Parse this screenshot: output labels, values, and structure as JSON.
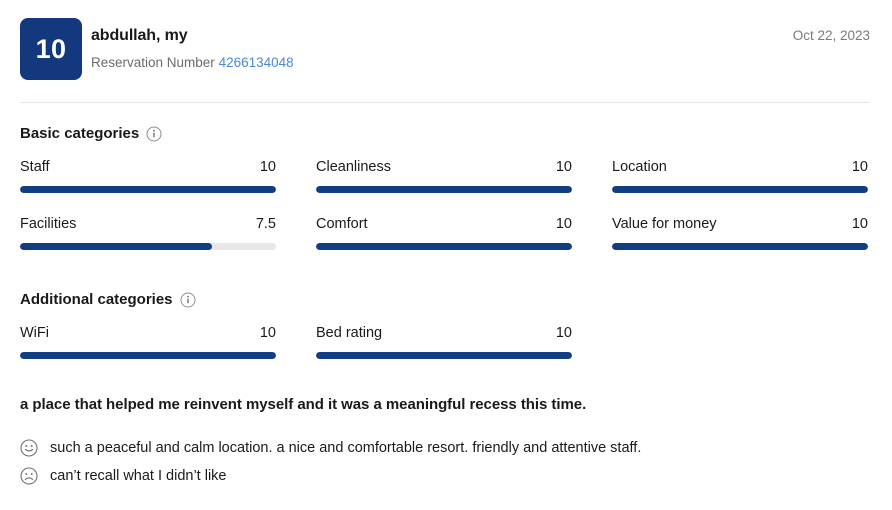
{
  "header": {
    "score": "10",
    "reviewer_name": "abdullah, my",
    "reservation_label": "Reservation Number",
    "reservation_number": "4266134048",
    "date": "Oct 22, 2023"
  },
  "sections": {
    "basic": {
      "title": "Basic categories",
      "info_icon": "info-icon",
      "ratings": [
        {
          "label": "Staff",
          "value": "10",
          "percent": 100
        },
        {
          "label": "Cleanliness",
          "value": "10",
          "percent": 100
        },
        {
          "label": "Location",
          "value": "10",
          "percent": 100
        },
        {
          "label": "Facilities",
          "value": "7.5",
          "percent": 75
        },
        {
          "label": "Comfort",
          "value": "10",
          "percent": 100
        },
        {
          "label": "Value for money",
          "value": "10",
          "percent": 100
        }
      ]
    },
    "additional": {
      "title": "Additional categories",
      "info_icon": "info-icon",
      "ratings": [
        {
          "label": "WiFi",
          "value": "10",
          "percent": 100
        },
        {
          "label": "Bed rating",
          "value": "10",
          "percent": 100
        }
      ]
    }
  },
  "review": {
    "title": "a place that helped me reinvent myself and it was a meaningful recess this time.",
    "positive": {
      "icon": "smiley-face-icon",
      "text": "such a peaceful and calm location. a nice and comfortable resort. friendly and attentive staff."
    },
    "negative": {
      "icon": "frowny-face-icon",
      "text": "can’t recall what I didn’t like"
    }
  },
  "colors": {
    "badge_blue": "#14387d",
    "bar_blue": "#113d81",
    "track_gray": "#e7e7e7",
    "link_blue": "#4a8ad4",
    "muted_text": "#6b6b6b",
    "divider": "#e4e4e4"
  }
}
